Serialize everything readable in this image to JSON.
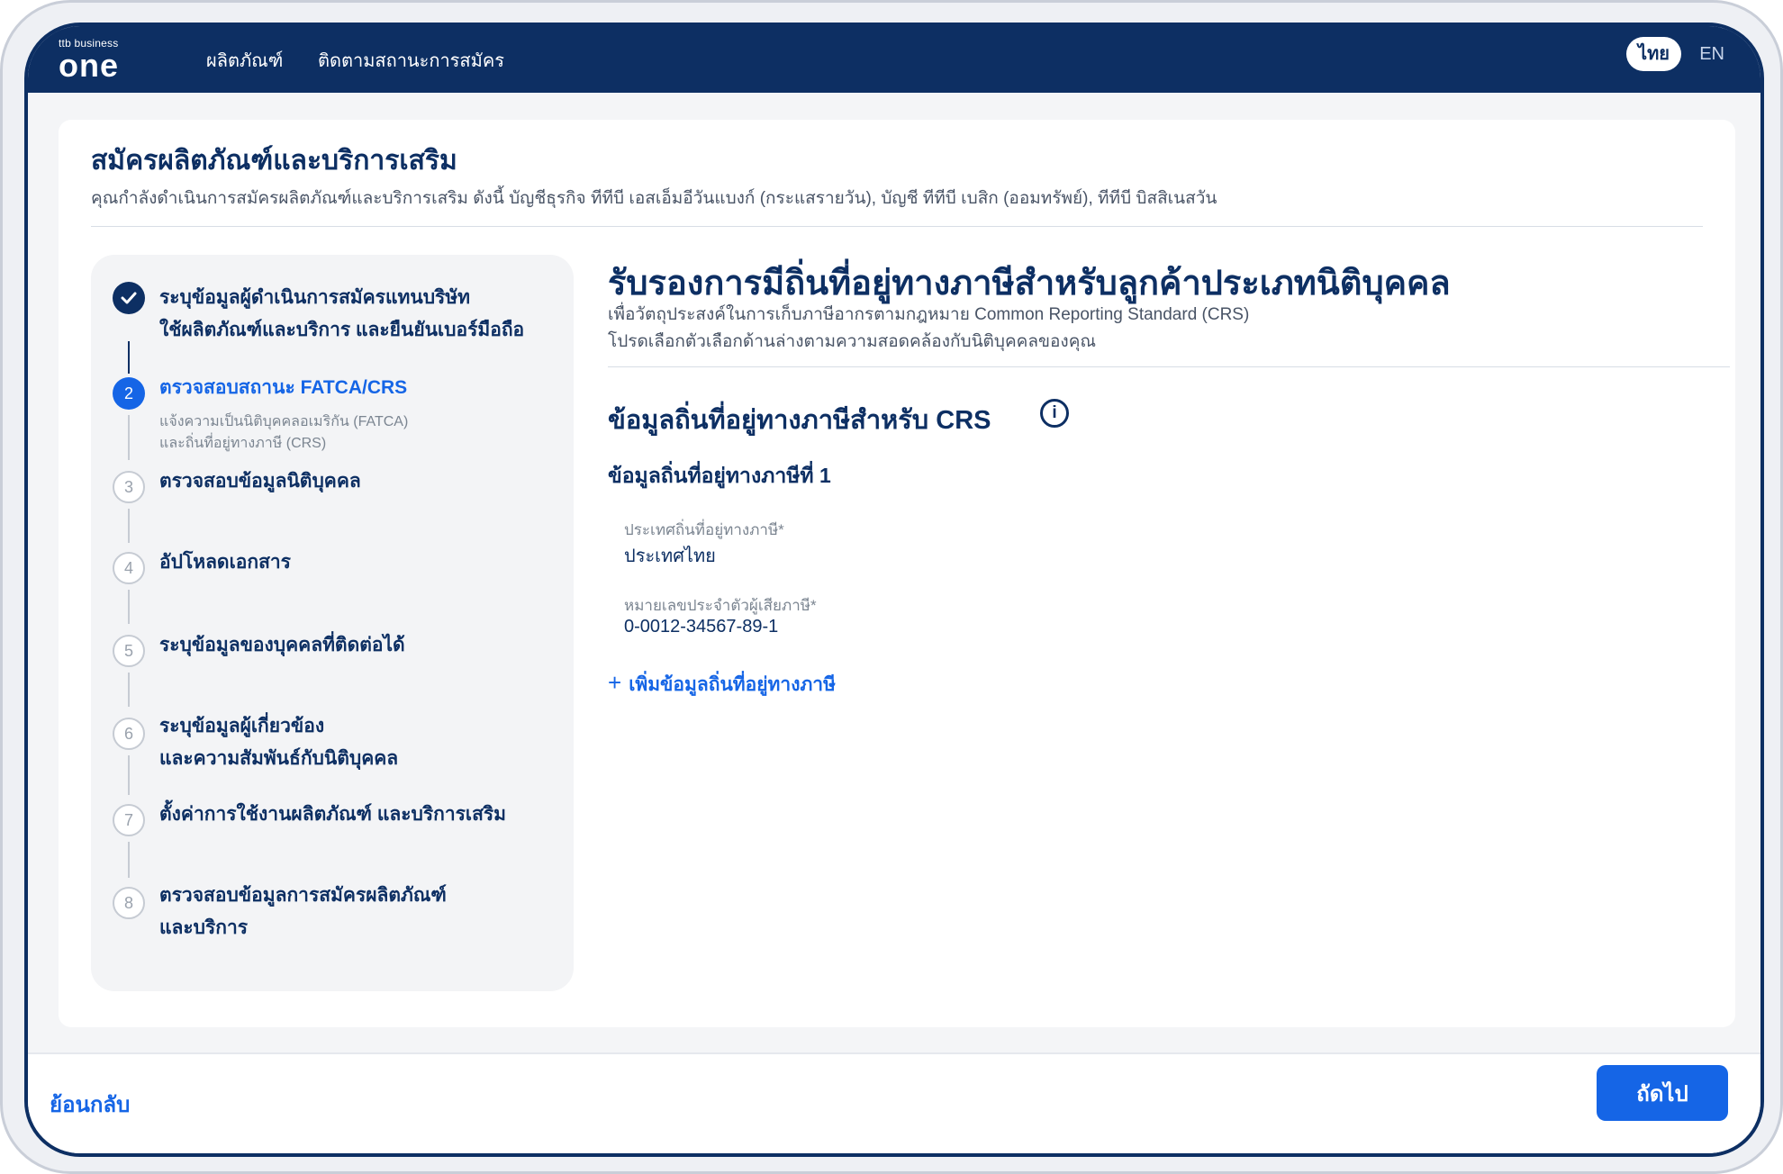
{
  "header": {
    "logo_small": "ttb business",
    "logo_big": "one",
    "nav": [
      "ผลิตภัณฑ์",
      "ติดตามสถานะการสมัคร"
    ],
    "lang_active": "ไทย",
    "lang_other": "EN"
  },
  "page": {
    "title": "สมัครผลิตภัณฑ์และบริการเสริม",
    "subtitle": "คุณกำลังดำเนินการสมัครผลิตภัณฑ์และบริการเสริม ดังนี้  บัญชีธุรกิจ ทีทีบี เอสเอ็มอีวันแบงก์ (กระแสรายวัน),  บัญชี ทีทีบี เบสิก (ออมทรัพย์),  ทีทีบี บิสสิเนสวัน"
  },
  "steps": [
    {
      "number": "✓",
      "line1": "ระบุข้อมูลผู้ดำเนินการสมัครแทนบริษัท",
      "line2": "ใช้ผลิตภัณฑ์และบริการ และยืนยันเบอร์มือถือ",
      "state": "done"
    },
    {
      "number": "2",
      "line1": "ตรวจสอบสถานะ FATCA/CRS",
      "desc1": "แจ้งความเป็นนิติบุคคลอเมริกัน (FATCA)",
      "desc2": "และถิ่นที่อยู่ทางภาษี (CRS)",
      "state": "active"
    },
    {
      "number": "3",
      "line1": "ตรวจสอบข้อมูลนิติบุคคล",
      "state": "todo"
    },
    {
      "number": "4",
      "line1": "อัปโหลดเอกสาร",
      "state": "todo"
    },
    {
      "number": "5",
      "line1": "ระบุข้อมูลของบุคคลที่ติดต่อได้",
      "state": "todo"
    },
    {
      "number": "6",
      "line1": "ระบุข้อมูลผู้เกี่ยวข้อง",
      "line2": "และความสัมพันธ์กับนิติบุคคล",
      "state": "todo"
    },
    {
      "number": "7",
      "line1": "ตั้งค่าการใช้งานผลิตภัณฑ์ และบริการเสริม",
      "state": "todo"
    },
    {
      "number": "8",
      "line1": "ตรวจสอบข้อมูลการสมัครผลิตภัณฑ์",
      "line2": "และบริการ",
      "state": "todo"
    }
  ],
  "content": {
    "heading": "รับรองการมีถิ่นที่อยู่ทางภาษีสำหรับลูกค้าประเภทนิติบุคคล",
    "desc1": "เพื่อวัตถุประสงค์ในการเก็บภาษีอากรตามกฎหมาย  Common Reporting Standard (CRS)",
    "desc2": "โปรดเลือกตัวเลือกด้านล่างตามความสอดคล้องกับนิติบุคคลของคุณ",
    "section_heading": "ข้อมูลถิ่นที่อยู่ทางภาษีสำหรับ CRS",
    "info_icon": "i",
    "sub_heading": "ข้อมูลถิ่นที่อยู่ทางภาษีที่ 1",
    "country_label": "ประเทศถิ่นที่อยู่ทางภาษี*",
    "country_value": "ประเทศไทย",
    "tin_label": "หมายเลขประจำตัวผู้เสียภาษี*",
    "tin_value": "0-0012-34567-89-1",
    "add_plus": "+",
    "add_label": "เพิ่มข้อมูลถิ่นที่อยู่ทางภาษี"
  },
  "footer": {
    "back_label": "ย้อนกลับ",
    "next_label": "ถัดไป"
  }
}
